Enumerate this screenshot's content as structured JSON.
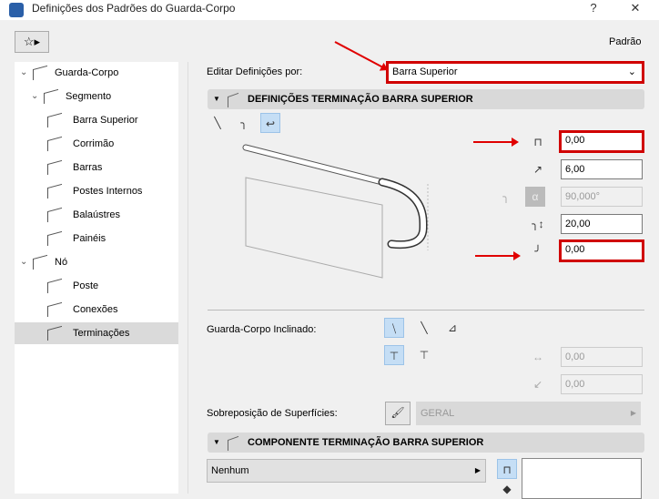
{
  "window": {
    "title": "Definições dos Padrões do Guarda-Corpo",
    "help": "?",
    "close": "✕"
  },
  "toolbar": {
    "favorites_label": "Padrão"
  },
  "tree": [
    {
      "label": "Guarda-Corpo",
      "level": 0,
      "expanded": true
    },
    {
      "label": "Segmento",
      "level": 1,
      "expanded": true
    },
    {
      "label": "Barra Superior",
      "level": 2
    },
    {
      "label": "Corrimão",
      "level": 2
    },
    {
      "label": "Barras",
      "level": 2
    },
    {
      "label": "Postes Internos",
      "level": 2
    },
    {
      "label": "Balaústres",
      "level": 2
    },
    {
      "label": "Painéis",
      "level": 2
    },
    {
      "label": "Nó",
      "level": 0,
      "expanded": true
    },
    {
      "label": "Poste",
      "level": 2
    },
    {
      "label": "Conexões",
      "level": 2
    },
    {
      "label": "Terminações",
      "level": 2,
      "selected": true
    }
  ],
  "edit_by": {
    "label": "Editar Definições por:",
    "value": "Barra Superior"
  },
  "section1": {
    "title": "DEFINIÇÕES TERMINAÇÃO BARRA SUPERIOR",
    "fields": {
      "extension": "0,00",
      "radius": "6,00",
      "angle": "90,000°",
      "height": "20,00",
      "bottom_ext": "0,00"
    }
  },
  "inclined": {
    "label": "Guarda-Corpo Inclinado:",
    "field1": "0,00",
    "field2": "0,00"
  },
  "surface": {
    "label": "Sobreposição de Superfícies:",
    "value": "GERAL"
  },
  "section2": {
    "title": "COMPONENTE TERMINAÇÃO BARRA SUPERIOR",
    "component": "Nenhum"
  },
  "colors": {
    "highlight": "#d00000",
    "selected": "#c5def5"
  }
}
